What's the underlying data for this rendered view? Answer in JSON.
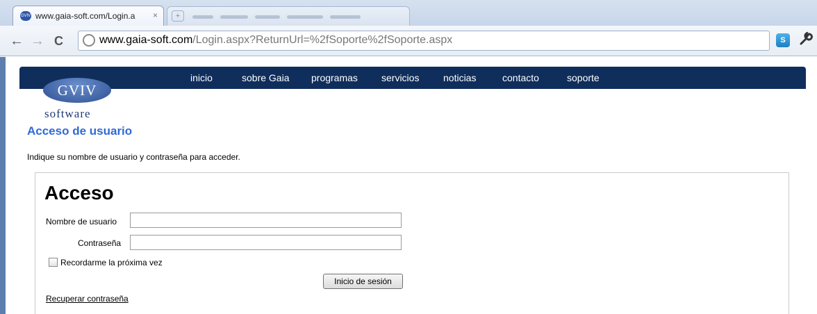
{
  "browser": {
    "tab_title": "www.gaia-soft.com/Login.a",
    "tab_close": "×",
    "new_tab": "+",
    "url_host": "www.gaia-soft.com",
    "url_path": "/Login.aspx?ReturnUrl=%2fSoporte%2fSoporte.aspx",
    "back": "←",
    "forward": "→",
    "reload": "C",
    "star": "☆",
    "ext": "S",
    "wrench": "🔧"
  },
  "nav": {
    "items": [
      {
        "label": "inicio"
      },
      {
        "label": "sobre Gaia"
      },
      {
        "label": "programas"
      },
      {
        "label": "servicios"
      },
      {
        "label": "noticias"
      },
      {
        "label": "contacto"
      },
      {
        "label": "soporte"
      }
    ]
  },
  "logo": {
    "badge": "GVIV",
    "software": "software"
  },
  "page": {
    "heading": "Acceso de usuario",
    "intro": "Indique su nombre de usuario y contraseña para acceder."
  },
  "login": {
    "title": "Acceso",
    "username_label": "Nombre de usuario",
    "username_value": "",
    "password_label": "Contraseña",
    "password_value": "",
    "remember_label": "Recordarme la próxima vez",
    "remember_checked": false,
    "submit_label": "Inicio de sesión",
    "recover_link": "Recuperar contraseña"
  }
}
